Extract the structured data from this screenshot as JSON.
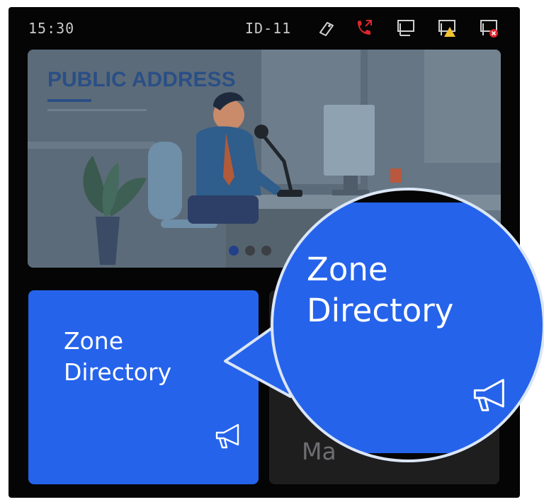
{
  "status_bar": {
    "time": "15:30",
    "device_id": "ID-11",
    "icons": [
      "tag-icon",
      "phone-call-red-icon",
      "network-monitor-icon",
      "network-warning-icon",
      "network-error-icon"
    ]
  },
  "banner": {
    "title": "PUBLIC ADDRESS",
    "carousel_dots": 3,
    "active_dot": 0
  },
  "tiles": [
    {
      "label_line1": "Zone",
      "label_line2": "Directory",
      "icon": "megaphone-icon",
      "color": "#2563eb"
    },
    {
      "label_partial": "Ma",
      "icon": "",
      "color": "#1e1e1f"
    }
  ],
  "zoom_callout": {
    "label_line1": "Zone",
    "label_line2": "Directory",
    "icon": "megaphone-icon",
    "color": "#2563eb"
  },
  "colors": {
    "accent_blue": "#2563eb",
    "status_red": "#e0262b",
    "warning_yellow": "#f2c230",
    "background": "#050505"
  }
}
